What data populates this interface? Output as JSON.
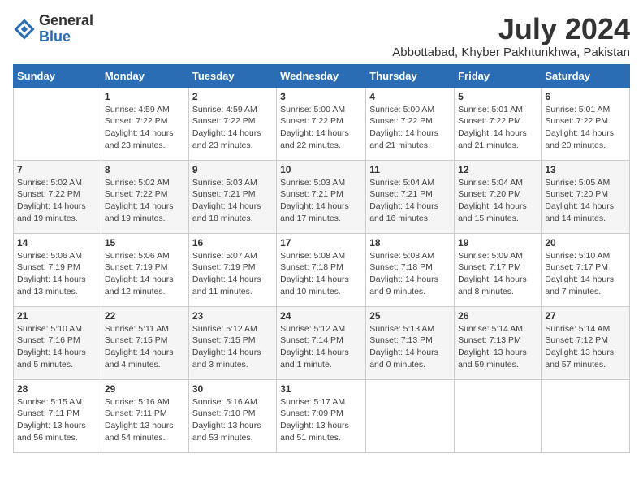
{
  "logo": {
    "general": "General",
    "blue": "Blue"
  },
  "title": {
    "month_year": "July 2024",
    "location": "Abbottabad, Khyber Pakhtunkhwa, Pakistan"
  },
  "calendar": {
    "headers": [
      "Sunday",
      "Monday",
      "Tuesday",
      "Wednesday",
      "Thursday",
      "Friday",
      "Saturday"
    ],
    "weeks": [
      [
        {
          "day": "",
          "info": ""
        },
        {
          "day": "1",
          "info": "Sunrise: 4:59 AM\nSunset: 7:22 PM\nDaylight: 14 hours\nand 23 minutes."
        },
        {
          "day": "2",
          "info": "Sunrise: 4:59 AM\nSunset: 7:22 PM\nDaylight: 14 hours\nand 23 minutes."
        },
        {
          "day": "3",
          "info": "Sunrise: 5:00 AM\nSunset: 7:22 PM\nDaylight: 14 hours\nand 22 minutes."
        },
        {
          "day": "4",
          "info": "Sunrise: 5:00 AM\nSunset: 7:22 PM\nDaylight: 14 hours\nand 21 minutes."
        },
        {
          "day": "5",
          "info": "Sunrise: 5:01 AM\nSunset: 7:22 PM\nDaylight: 14 hours\nand 21 minutes."
        },
        {
          "day": "6",
          "info": "Sunrise: 5:01 AM\nSunset: 7:22 PM\nDaylight: 14 hours\nand 20 minutes."
        }
      ],
      [
        {
          "day": "7",
          "info": "Sunrise: 5:02 AM\nSunset: 7:22 PM\nDaylight: 14 hours\nand 19 minutes."
        },
        {
          "day": "8",
          "info": "Sunrise: 5:02 AM\nSunset: 7:22 PM\nDaylight: 14 hours\nand 19 minutes."
        },
        {
          "day": "9",
          "info": "Sunrise: 5:03 AM\nSunset: 7:21 PM\nDaylight: 14 hours\nand 18 minutes."
        },
        {
          "day": "10",
          "info": "Sunrise: 5:03 AM\nSunset: 7:21 PM\nDaylight: 14 hours\nand 17 minutes."
        },
        {
          "day": "11",
          "info": "Sunrise: 5:04 AM\nSunset: 7:21 PM\nDaylight: 14 hours\nand 16 minutes."
        },
        {
          "day": "12",
          "info": "Sunrise: 5:04 AM\nSunset: 7:20 PM\nDaylight: 14 hours\nand 15 minutes."
        },
        {
          "day": "13",
          "info": "Sunrise: 5:05 AM\nSunset: 7:20 PM\nDaylight: 14 hours\nand 14 minutes."
        }
      ],
      [
        {
          "day": "14",
          "info": "Sunrise: 5:06 AM\nSunset: 7:19 PM\nDaylight: 14 hours\nand 13 minutes."
        },
        {
          "day": "15",
          "info": "Sunrise: 5:06 AM\nSunset: 7:19 PM\nDaylight: 14 hours\nand 12 minutes."
        },
        {
          "day": "16",
          "info": "Sunrise: 5:07 AM\nSunset: 7:19 PM\nDaylight: 14 hours\nand 11 minutes."
        },
        {
          "day": "17",
          "info": "Sunrise: 5:08 AM\nSunset: 7:18 PM\nDaylight: 14 hours\nand 10 minutes."
        },
        {
          "day": "18",
          "info": "Sunrise: 5:08 AM\nSunset: 7:18 PM\nDaylight: 14 hours\nand 9 minutes."
        },
        {
          "day": "19",
          "info": "Sunrise: 5:09 AM\nSunset: 7:17 PM\nDaylight: 14 hours\nand 8 minutes."
        },
        {
          "day": "20",
          "info": "Sunrise: 5:10 AM\nSunset: 7:17 PM\nDaylight: 14 hours\nand 7 minutes."
        }
      ],
      [
        {
          "day": "21",
          "info": "Sunrise: 5:10 AM\nSunset: 7:16 PM\nDaylight: 14 hours\nand 5 minutes."
        },
        {
          "day": "22",
          "info": "Sunrise: 5:11 AM\nSunset: 7:15 PM\nDaylight: 14 hours\nand 4 minutes."
        },
        {
          "day": "23",
          "info": "Sunrise: 5:12 AM\nSunset: 7:15 PM\nDaylight: 14 hours\nand 3 minutes."
        },
        {
          "day": "24",
          "info": "Sunrise: 5:12 AM\nSunset: 7:14 PM\nDaylight: 14 hours\nand 1 minute."
        },
        {
          "day": "25",
          "info": "Sunrise: 5:13 AM\nSunset: 7:13 PM\nDaylight: 14 hours\nand 0 minutes."
        },
        {
          "day": "26",
          "info": "Sunrise: 5:14 AM\nSunset: 7:13 PM\nDaylight: 13 hours\nand 59 minutes."
        },
        {
          "day": "27",
          "info": "Sunrise: 5:14 AM\nSunset: 7:12 PM\nDaylight: 13 hours\nand 57 minutes."
        }
      ],
      [
        {
          "day": "28",
          "info": "Sunrise: 5:15 AM\nSunset: 7:11 PM\nDaylight: 13 hours\nand 56 minutes."
        },
        {
          "day": "29",
          "info": "Sunrise: 5:16 AM\nSunset: 7:11 PM\nDaylight: 13 hours\nand 54 minutes."
        },
        {
          "day": "30",
          "info": "Sunrise: 5:16 AM\nSunset: 7:10 PM\nDaylight: 13 hours\nand 53 minutes."
        },
        {
          "day": "31",
          "info": "Sunrise: 5:17 AM\nSunset: 7:09 PM\nDaylight: 13 hours\nand 51 minutes."
        },
        {
          "day": "",
          "info": ""
        },
        {
          "day": "",
          "info": ""
        },
        {
          "day": "",
          "info": ""
        }
      ]
    ]
  }
}
